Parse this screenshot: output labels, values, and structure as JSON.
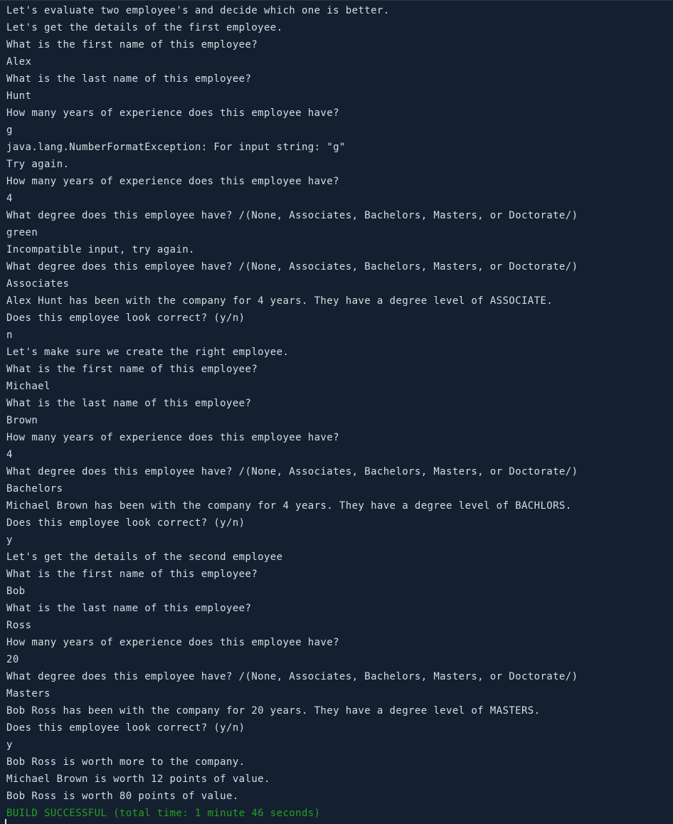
{
  "colors": {
    "background": "#14202f",
    "text": "#d8dde4",
    "success": "#24a024"
  },
  "output": {
    "lines": [
      {
        "text": "Let's evaluate two employee's and decide which one is better.",
        "kind": "text"
      },
      {
        "text": "Let's get the details of the first employee.",
        "kind": "text"
      },
      {
        "text": "What is the first name of this employee?",
        "kind": "text"
      },
      {
        "text": "Alex",
        "kind": "text"
      },
      {
        "text": "What is the last name of this employee?",
        "kind": "text"
      },
      {
        "text": "Hunt",
        "kind": "text"
      },
      {
        "text": "How many years of experience does this employee have?",
        "kind": "text"
      },
      {
        "text": "g",
        "kind": "text"
      },
      {
        "text": "java.lang.NumberFormatException: For input string: \"g\"",
        "kind": "text"
      },
      {
        "text": "Try again.",
        "kind": "text"
      },
      {
        "text": "How many years of experience does this employee have?",
        "kind": "text"
      },
      {
        "text": "4",
        "kind": "text"
      },
      {
        "text": "What degree does this employee have? /(None, Associates, Bachelors, Masters, or Doctorate/)",
        "kind": "text"
      },
      {
        "text": "green",
        "kind": "text"
      },
      {
        "text": "Incompatible input, try again.",
        "kind": "text"
      },
      {
        "text": "What degree does this employee have? /(None, Associates, Bachelors, Masters, or Doctorate/)",
        "kind": "text"
      },
      {
        "text": "Associates",
        "kind": "text"
      },
      {
        "text": "Alex Hunt has been with the company for 4 years. They have a degree level of ASSOCIATE.",
        "kind": "text"
      },
      {
        "text": "Does this employee look correct? (y/n)",
        "kind": "text"
      },
      {
        "text": "n",
        "kind": "text"
      },
      {
        "text": "Let's make sure we create the right employee.",
        "kind": "text"
      },
      {
        "text": "What is the first name of this employee?",
        "kind": "text"
      },
      {
        "text": "Michael",
        "kind": "text"
      },
      {
        "text": "What is the last name of this employee?",
        "kind": "text"
      },
      {
        "text": "Brown",
        "kind": "text"
      },
      {
        "text": "How many years of experience does this employee have?",
        "kind": "text"
      },
      {
        "text": "4",
        "kind": "text"
      },
      {
        "text": "What degree does this employee have? /(None, Associates, Bachelors, Masters, or Doctorate/)",
        "kind": "text"
      },
      {
        "text": "Bachelors",
        "kind": "text"
      },
      {
        "text": "Michael Brown has been with the company for 4 years. They have a degree level of BACHLORS.",
        "kind": "text"
      },
      {
        "text": "Does this employee look correct? (y/n)",
        "kind": "text"
      },
      {
        "text": "y",
        "kind": "text"
      },
      {
        "text": "Let's get the details of the second employee",
        "kind": "text"
      },
      {
        "text": "What is the first name of this employee?",
        "kind": "text"
      },
      {
        "text": "Bob",
        "kind": "text"
      },
      {
        "text": "What is the last name of this employee?",
        "kind": "text"
      },
      {
        "text": "Ross",
        "kind": "text"
      },
      {
        "text": "How many years of experience does this employee have?",
        "kind": "text"
      },
      {
        "text": "20",
        "kind": "text"
      },
      {
        "text": "What degree does this employee have? /(None, Associates, Bachelors, Masters, or Doctorate/)",
        "kind": "text"
      },
      {
        "text": "Masters",
        "kind": "text"
      },
      {
        "text": "Bob Ross has been with the company for 20 years. They have a degree level of MASTERS.",
        "kind": "text"
      },
      {
        "text": "Does this employee look correct? (y/n)",
        "kind": "text"
      },
      {
        "text": "y",
        "kind": "text"
      },
      {
        "text": "Bob Ross is worth more to the company.",
        "kind": "text"
      },
      {
        "text": "Michael Brown is worth 12 points of value.",
        "kind": "text"
      },
      {
        "text": "Bob Ross is worth 80 points of value.",
        "kind": "text"
      },
      {
        "text": "BUILD SUCCESSFUL (total time: 1 minute 46 seconds)",
        "kind": "success"
      }
    ]
  }
}
